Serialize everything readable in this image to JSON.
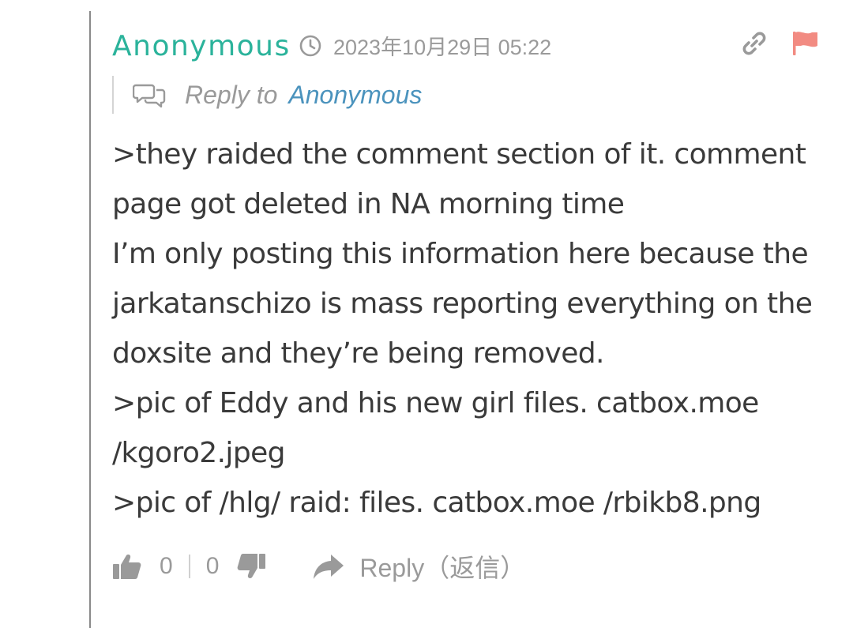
{
  "comment": {
    "author": "Anonymous",
    "timestamp": "2023年10月29日 05:22",
    "reply_label": "Reply to",
    "reply_target": "Anonymous",
    "lines": [
      ">they raided the comment section of it. comment",
      "page got deleted in NA morning time",
      "I’m only posting this information here because the",
      "jarkatanschizo is mass reporting everything on the",
      "doxsite and they’re being removed.",
      ">pic of Eddy and his new girl files. catbox.moe",
      "/kgoro2.jpeg",
      ">pic of /hlg/ raid: files. catbox.moe /rbikb8.png"
    ],
    "upvotes": "0",
    "downvotes": "0",
    "reply_button": "Reply（返信）"
  },
  "icons": {
    "clock": "clock-icon",
    "link": "link-icon",
    "flag": "flag-icon",
    "reply_to": "speech-bubbles-icon",
    "thumbs_up": "thumbs-up-icon",
    "thumbs_down": "thumbs-down-icon",
    "reply": "share-arrow-icon"
  },
  "colors": {
    "author": "#2bb39b",
    "link": "#4b93bd",
    "flag": "#f28b82",
    "muted": "#9a9a9a",
    "text": "#3a3a3a"
  }
}
